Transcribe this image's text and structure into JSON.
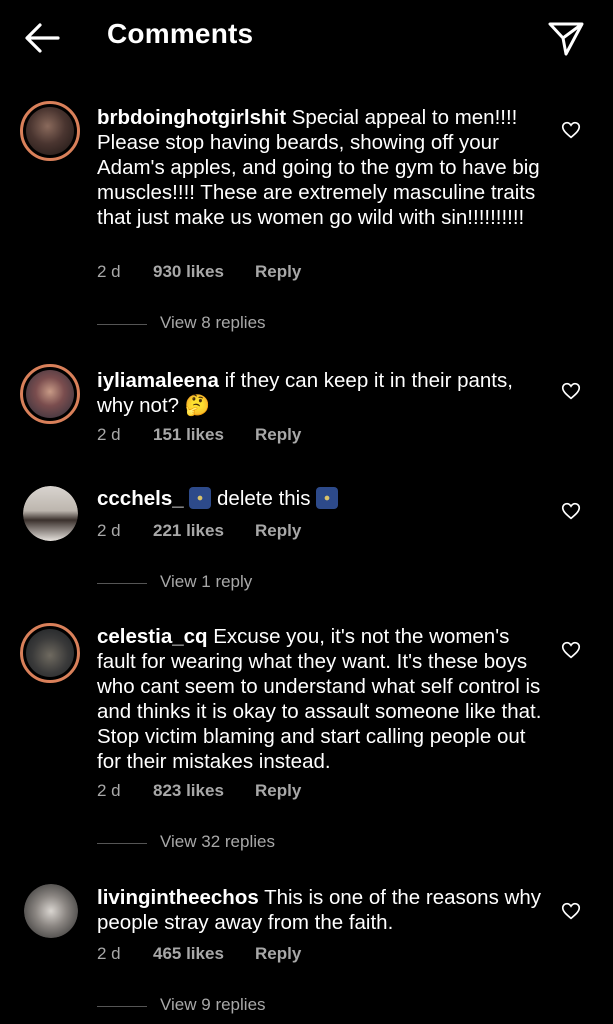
{
  "header": {
    "title": "Comments",
    "back_icon": "arrow-left-icon",
    "send_icon": "paper-plane-icon"
  },
  "comments": [
    {
      "username": "brbdoinghotgirlshit",
      "text": " Special appeal to men!!!! Please stop having beards, showing off your Adam's apples, and going to the gym to have big muscles!!!! These are extremely masculine traits that just make us women go wild with sin!!!!!!!!!!",
      "time": "2 d",
      "likes": "930 likes",
      "reply": "Reply",
      "view_replies": "View 8 replies"
    },
    {
      "username": "iyliamaleena",
      "text": " if they can keep it in their pants, why not? ",
      "emoji": "🤔",
      "time": "2 d",
      "likes": "151 likes",
      "reply": "Reply"
    },
    {
      "username": "ccchels_",
      "text": "delete this",
      "time": "2 d",
      "likes": "221 likes",
      "reply": "Reply",
      "view_replies": "View 1 reply"
    },
    {
      "username": "celestia_cq",
      "text": " Excuse you, it's not the women's fault for wearing what they want. It's these boys who cant seem to understand what self control is and thinks it is okay to assault someone like that. Stop victim blaming and start calling people out for their mistakes instead.",
      "time": "2 d",
      "likes": "823 likes",
      "reply": "Reply",
      "view_replies": "View 32 replies"
    },
    {
      "username": "livingintheechos",
      "text": " This is one of the reasons why people stray away from the faith.",
      "time": "2 d",
      "likes": "465 likes",
      "reply": "Reply",
      "view_replies": "View 9 replies"
    }
  ],
  "colors": {
    "background": "#000000",
    "text": "#ffffff",
    "muted": "#a8a8a8",
    "story_ring": "#d9805a"
  }
}
